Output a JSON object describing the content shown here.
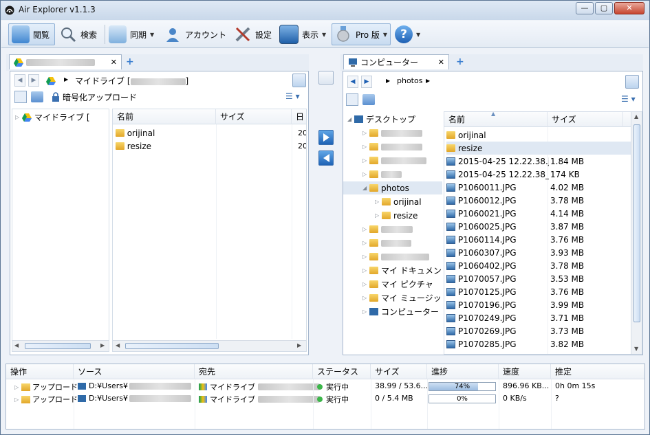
{
  "window": {
    "title": "Air Explorer v1.1.3",
    "min": "—",
    "max": "▢",
    "close": "✕"
  },
  "toolbar": {
    "browse": "閲覧",
    "search": "検索",
    "sync": "同期",
    "account": "アカウント",
    "settings": "設定",
    "view": "表示",
    "pro": "Pro 版",
    "help": "?"
  },
  "left": {
    "tab_add": "+",
    "breadcrumb_root": "マイドライブ [",
    "breadcrumb_end": "]",
    "encrypt_label": "暗号化アップロード",
    "tree_root": "マイドライブ [",
    "columns": {
      "name": "名前",
      "size": "サイズ",
      "date": "日"
    },
    "files": [
      {
        "name": "orijinal",
        "date": "20"
      },
      {
        "name": "resize",
        "date": "20"
      }
    ]
  },
  "right": {
    "tab_label": "コンピューター",
    "tab_close": "✕",
    "tab_add": "+",
    "breadcrumb": "photos",
    "tree": {
      "desktop": "デスクトップ",
      "photos": "photos",
      "orijinal": "orijinal",
      "resize": "resize",
      "documents": "マイ ドキュメン",
      "pictures": "マイ ピクチャ",
      "music": "マイ ミュージッ",
      "computer": "コンピューター"
    },
    "columns": {
      "name": "名前",
      "size": "サイズ"
    },
    "files": [
      {
        "name": "orijinal",
        "size": "",
        "type": "folder"
      },
      {
        "name": "resize",
        "size": "",
        "type": "folder"
      },
      {
        "name": "2015-04-25 12.22.38.jpg",
        "size": "1.84 MB",
        "type": "image"
      },
      {
        "name": "2015-04-25 12.22.38_4...",
        "size": "174 KB",
        "type": "image"
      },
      {
        "name": "P1060011.JPG",
        "size": "4.02 MB",
        "type": "image"
      },
      {
        "name": "P1060012.JPG",
        "size": "3.78 MB",
        "type": "image"
      },
      {
        "name": "P1060021.JPG",
        "size": "4.14 MB",
        "type": "image"
      },
      {
        "name": "P1060025.JPG",
        "size": "3.87 MB",
        "type": "image"
      },
      {
        "name": "P1060114.JPG",
        "size": "3.76 MB",
        "type": "image"
      },
      {
        "name": "P1060307.JPG",
        "size": "3.93 MB",
        "type": "image"
      },
      {
        "name": "P1060402.JPG",
        "size": "3.78 MB",
        "type": "image"
      },
      {
        "name": "P1070057.JPG",
        "size": "3.53 MB",
        "type": "image"
      },
      {
        "name": "P1070125.JPG",
        "size": "3.76 MB",
        "type": "image"
      },
      {
        "name": "P1070196.JPG",
        "size": "3.99 MB",
        "type": "image"
      },
      {
        "name": "P1070249.JPG",
        "size": "3.71 MB",
        "type": "image"
      },
      {
        "name": "P1070269.JPG",
        "size": "3.73 MB",
        "type": "image"
      },
      {
        "name": "P1070285.JPG",
        "size": "3.82 MB",
        "type": "image"
      }
    ]
  },
  "transfers": {
    "columns": {
      "op": "操作",
      "source": "ソース",
      "dest": "宛先",
      "status": "ステータス",
      "size": "サイズ",
      "progress": "進捗",
      "speed": "速度",
      "eta": "推定"
    },
    "rows": [
      {
        "op": "アップロード",
        "source": "D:¥Users¥",
        "dest": "マイドライブ",
        "status": "実行中",
        "size": "38.99 / 53.6...",
        "progress_label": "74%",
        "progress_pct": 74,
        "speed": "896.96 KB...",
        "eta": "0h 0m 15s"
      },
      {
        "op": "アップロード",
        "source": "D:¥Users¥",
        "dest": "マイドライブ",
        "status": "実行中",
        "size": "0 / 5.4 MB",
        "progress_label": "0%",
        "progress_pct": 0,
        "speed": "0 KB/s",
        "eta": "?"
      }
    ]
  },
  "colors": {
    "accent": "#1f63b5",
    "status_ok": "#3cb64a"
  }
}
